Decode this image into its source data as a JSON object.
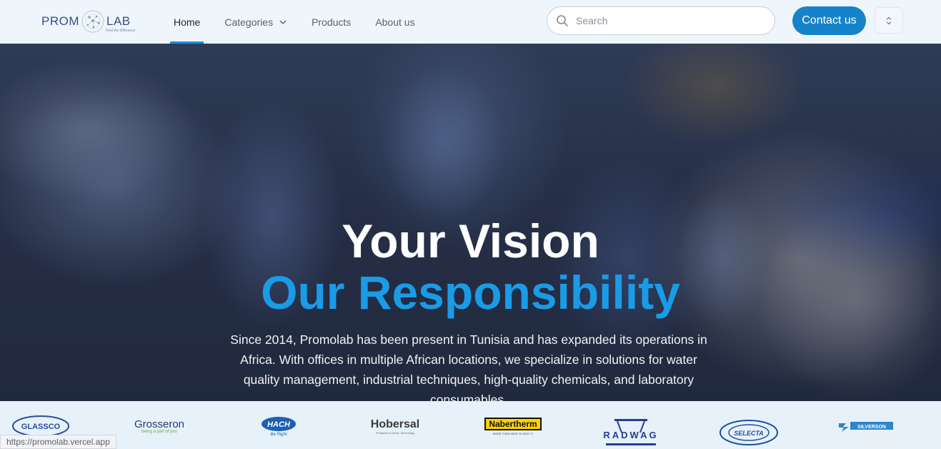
{
  "brand": {
    "logo_left": "PROM",
    "logo_right": "LAB",
    "logo_tagline": "Feel the difference"
  },
  "nav": {
    "items": [
      {
        "label": "Home",
        "active": true
      },
      {
        "label": "Categories",
        "has_dropdown": true
      },
      {
        "label": "Products"
      },
      {
        "label": "About us"
      }
    ],
    "search_placeholder": "Search",
    "contact_label": "Contact us",
    "icons": [
      "search-icon",
      "chevron-down-icon",
      "select-chevrons-icon"
    ]
  },
  "hero": {
    "title_line1": "Your Vision",
    "title_line2": "Our Responsibility",
    "description": "Since 2014, Promolab has been present in Tunisia and has expanded its operations in Africa. With offices in multiple African locations, we specialize in solutions for water quality management, industrial techniques, high-quality chemicals, and laboratory consumables."
  },
  "partners": {
    "logos": [
      {
        "name": "GLASSCO"
      },
      {
        "name": "Grosseron",
        "tagline": "being a part of you"
      },
      {
        "name": "HACH",
        "tagline": "Be Right"
      },
      {
        "name": "Hobersal",
        "tagline": "Furnaces & Ovens Technology"
      },
      {
        "name": "Nabertherm",
        "tagline": "MORE THAN HEAT 30-3000 °C"
      },
      {
        "name": "RADWAG"
      },
      {
        "name": "SELECTA"
      },
      {
        "name": "SILVERSON"
      }
    ]
  },
  "status_bar": {
    "url": "https://promolab.vercel.app"
  },
  "colors": {
    "accent": "#1583c9",
    "hero_highlight": "#1a9be6",
    "logo_text": "#3a4d82"
  }
}
